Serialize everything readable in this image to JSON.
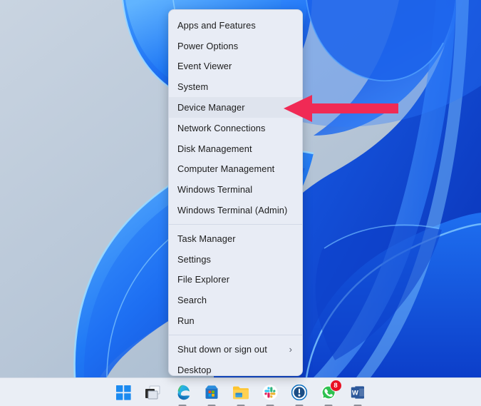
{
  "desktop": {
    "wallpaper_name": "windows-11-bloom-wallpaper",
    "wallpaper_colors": [
      "#c6d2df",
      "#1c6ff5",
      "#0b3fd0",
      "#4aa9ff",
      "#1356e0"
    ]
  },
  "context_menu": {
    "name": "win-x-quick-link-menu",
    "groups": [
      {
        "items": [
          {
            "label": "Apps and Features",
            "highlighted": false,
            "submenu": false
          },
          {
            "label": "Power Options",
            "highlighted": false,
            "submenu": false
          },
          {
            "label": "Event Viewer",
            "highlighted": false,
            "submenu": false
          },
          {
            "label": "System",
            "highlighted": false,
            "submenu": false
          },
          {
            "label": "Device Manager",
            "highlighted": true,
            "submenu": false
          },
          {
            "label": "Network Connections",
            "highlighted": false,
            "submenu": false
          },
          {
            "label": "Disk Management",
            "highlighted": false,
            "submenu": false
          },
          {
            "label": "Computer Management",
            "highlighted": false,
            "submenu": false
          },
          {
            "label": "Windows Terminal",
            "highlighted": false,
            "submenu": false
          },
          {
            "label": "Windows Terminal (Admin)",
            "highlighted": false,
            "submenu": false
          }
        ]
      },
      {
        "items": [
          {
            "label": "Task Manager",
            "highlighted": false,
            "submenu": false
          },
          {
            "label": "Settings",
            "highlighted": false,
            "submenu": false
          },
          {
            "label": "File Explorer",
            "highlighted": false,
            "submenu": false
          },
          {
            "label": "Search",
            "highlighted": false,
            "submenu": false
          },
          {
            "label": "Run",
            "highlighted": false,
            "submenu": false
          }
        ]
      },
      {
        "items": [
          {
            "label": "Shut down or sign out",
            "highlighted": false,
            "submenu": true,
            "submenu_glyph": "›"
          },
          {
            "label": "Desktop",
            "highlighted": false,
            "submenu": false
          }
        ]
      }
    ]
  },
  "annotation": {
    "type": "arrow",
    "name": "red-pointer-arrow",
    "color": "#F02A55",
    "points_to": "Device Manager"
  },
  "taskbar": {
    "background": "#eaeef5",
    "items": [
      {
        "name": "start-button",
        "icon": "windows-start-icon",
        "label": "Start",
        "running": false,
        "badge": null
      },
      {
        "name": "task-view-button",
        "icon": "task-view-icon",
        "label": "Task View",
        "running": false,
        "badge": null
      },
      {
        "name": "edge-button",
        "icon": "microsoft-edge-icon",
        "label": "Microsoft Edge",
        "running": true,
        "badge": null
      },
      {
        "name": "microsoft-store-button",
        "icon": "microsoft-store-icon",
        "label": "Microsoft Store",
        "running": true,
        "badge": null
      },
      {
        "name": "file-explorer-button",
        "icon": "file-explorer-icon",
        "label": "File Explorer",
        "running": true,
        "badge": null
      },
      {
        "name": "slack-button",
        "icon": "slack-icon",
        "label": "Slack",
        "running": true,
        "badge": null
      },
      {
        "name": "onepassword-button",
        "icon": "1password-icon",
        "label": "1Password",
        "running": true,
        "badge": null
      },
      {
        "name": "whatsapp-button",
        "icon": "whatsapp-icon",
        "label": "WhatsApp",
        "running": true,
        "badge": "8"
      },
      {
        "name": "word-button",
        "icon": "microsoft-word-icon",
        "label": "Microsoft Word",
        "running": true,
        "badge": null
      }
    ]
  }
}
